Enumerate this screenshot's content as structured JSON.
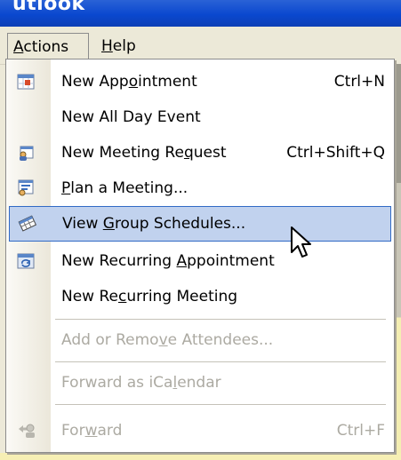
{
  "app": {
    "title_fragment": "utlook"
  },
  "menubar": {
    "items": [
      {
        "label_pre": "",
        "label_ul": "A",
        "label_post": "ctions"
      },
      {
        "label_pre": "",
        "label_ul": "H",
        "label_post": "elp"
      }
    ]
  },
  "menu": {
    "items": [
      {
        "pre": "New App",
        "ul": "o",
        "post": "intment",
        "shortcut": "Ctrl+N",
        "icon": "calendar-icon",
        "enabled": true
      },
      {
        "pre": "New All Day Event",
        "ul": "",
        "post": "",
        "shortcut": "",
        "icon": "",
        "enabled": true
      },
      {
        "pre": "New Meeting Re",
        "ul": "q",
        "post": "uest",
        "shortcut": "Ctrl+Shift+Q",
        "icon": "meeting-request-icon",
        "enabled": true
      },
      {
        "pre": "",
        "ul": "P",
        "post": "lan a Meeting...",
        "shortcut": "",
        "icon": "plan-meeting-icon",
        "enabled": true
      },
      {
        "pre": "View ",
        "ul": "G",
        "post": "roup Schedules...",
        "shortcut": "",
        "icon": "group-schedules-icon",
        "enabled": true,
        "highlighted": true
      },
      {
        "pre": "New Recurring ",
        "ul": "A",
        "post": "ppointment",
        "shortcut": "",
        "icon": "recurring-appointment-icon",
        "enabled": true
      },
      {
        "pre": "New Re",
        "ul": "c",
        "post": "urring Meeting",
        "shortcut": "",
        "icon": "",
        "enabled": true
      },
      {
        "pre": "Add or Remo",
        "ul": "v",
        "post": "e Attendees...",
        "shortcut": "",
        "icon": "",
        "enabled": false
      },
      {
        "pre": "Forward as iCa",
        "ul": "l",
        "post": "endar",
        "shortcut": "",
        "icon": "",
        "enabled": false
      },
      {
        "pre": "For",
        "ul": "w",
        "post": "ard",
        "shortcut": "Ctrl+F",
        "icon": "forward-icon",
        "enabled": false
      }
    ]
  },
  "colors": {
    "highlight_bg": "#c1d2ee",
    "highlight_border": "#316ac5",
    "disabled_text": "#acaaa2"
  }
}
